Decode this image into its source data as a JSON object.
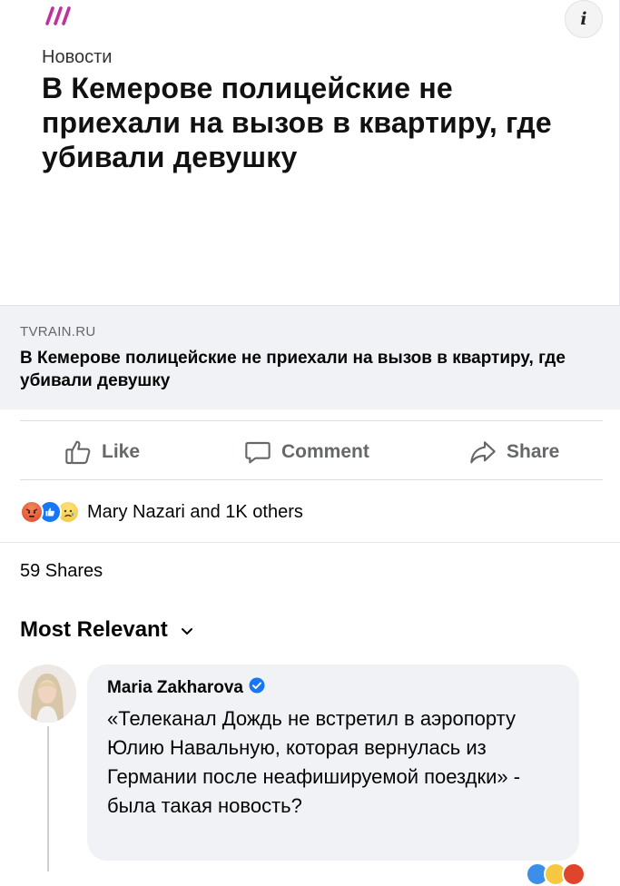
{
  "preview": {
    "logo_icon": "tvrain-logo-icon",
    "info_icon": "info-icon",
    "info_label": "i",
    "category": "Новости",
    "title": "В Кемерове полицейские не приехали на вызов в квартиру, где убивали девушку"
  },
  "link": {
    "domain": "TVRAIN.RU",
    "title": "В Кемерове полицейские не приехали на вызов в квартиру, где убивали девушку"
  },
  "actions": {
    "like": "Like",
    "comment": "Comment",
    "share": "Share"
  },
  "reactions": {
    "icons": [
      "angry-reaction-icon",
      "like-reaction-icon",
      "sad-reaction-icon"
    ],
    "summary": "Mary Nazari and 1K others"
  },
  "shares": "59 Shares",
  "sort": {
    "label": "Most Relevant"
  },
  "comment": {
    "author": "Maria Zakharova",
    "verified_icon": "verified-badge-icon",
    "text": "«Телеканал Дождь не встретил в аэропорту Юлию Навальную, которая вернулась из Германии после неафишируемой поездки» - была такая новость?"
  },
  "colors": {
    "brand_logo": "#c0319a",
    "facebook_blue": "#1877f2",
    "muted_text": "#65676b",
    "link_box_bg": "#f0f2f5"
  }
}
